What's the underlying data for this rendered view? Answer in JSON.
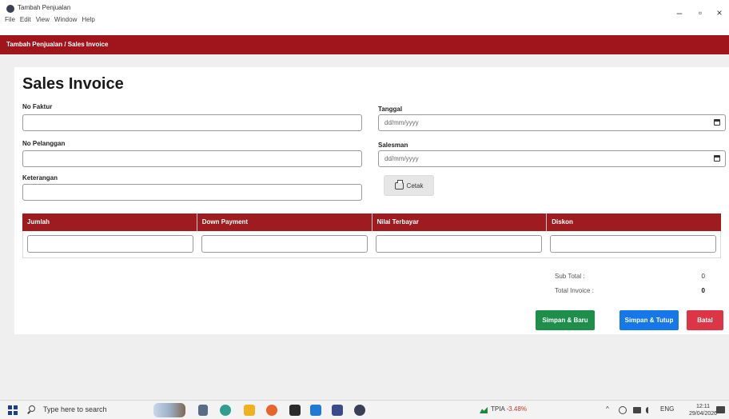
{
  "window": {
    "title": "Tambah Penjualan",
    "menu": [
      "File",
      "Edit",
      "View",
      "Window",
      "Help"
    ],
    "controls": {
      "minimize": "–",
      "maximize": "▫",
      "close": "×"
    }
  },
  "breadcrumb": "Tambah Penjualan / Sales Invoice",
  "form": {
    "title": "Sales Invoice",
    "no_faktur": {
      "label": "No Faktur",
      "value": ""
    },
    "no_pelanggan": {
      "label": "No Pelanggan",
      "value": ""
    },
    "keterangan": {
      "label": "Keterangan",
      "value": ""
    },
    "tanggal": {
      "label": "Tanggal",
      "placeholder": "dd/mm/yyyy"
    },
    "salesman": {
      "label": "Salesman",
      "placeholder": "dd/mm/yyyy"
    },
    "print_label": "Cetak"
  },
  "table": {
    "headers": [
      "Jumlah",
      "Down Payment",
      "Nilai Terbayar",
      "Diskon"
    ]
  },
  "summary": {
    "sub_total_label": "Sub Total :",
    "sub_total_value": "0",
    "total_invoice_label": "Total Invoice :",
    "total_invoice_value": "0"
  },
  "buttons": {
    "save_new": "Simpan & Baru",
    "save_close": "Simpan & Tutup",
    "cancel": "Batal"
  },
  "taskbar": {
    "search_placeholder": "Type here to search",
    "stock_name": "TPIA",
    "stock_change": "-3.48%",
    "language": "ENG",
    "time": "12:11",
    "date": "29/04/2026"
  },
  "colors": {
    "brand_red": "#a0141c",
    "table_header": "#9e1c1f",
    "save_new": "#1e8f4a",
    "save_close": "#1577e8",
    "cancel": "#dc3545"
  }
}
